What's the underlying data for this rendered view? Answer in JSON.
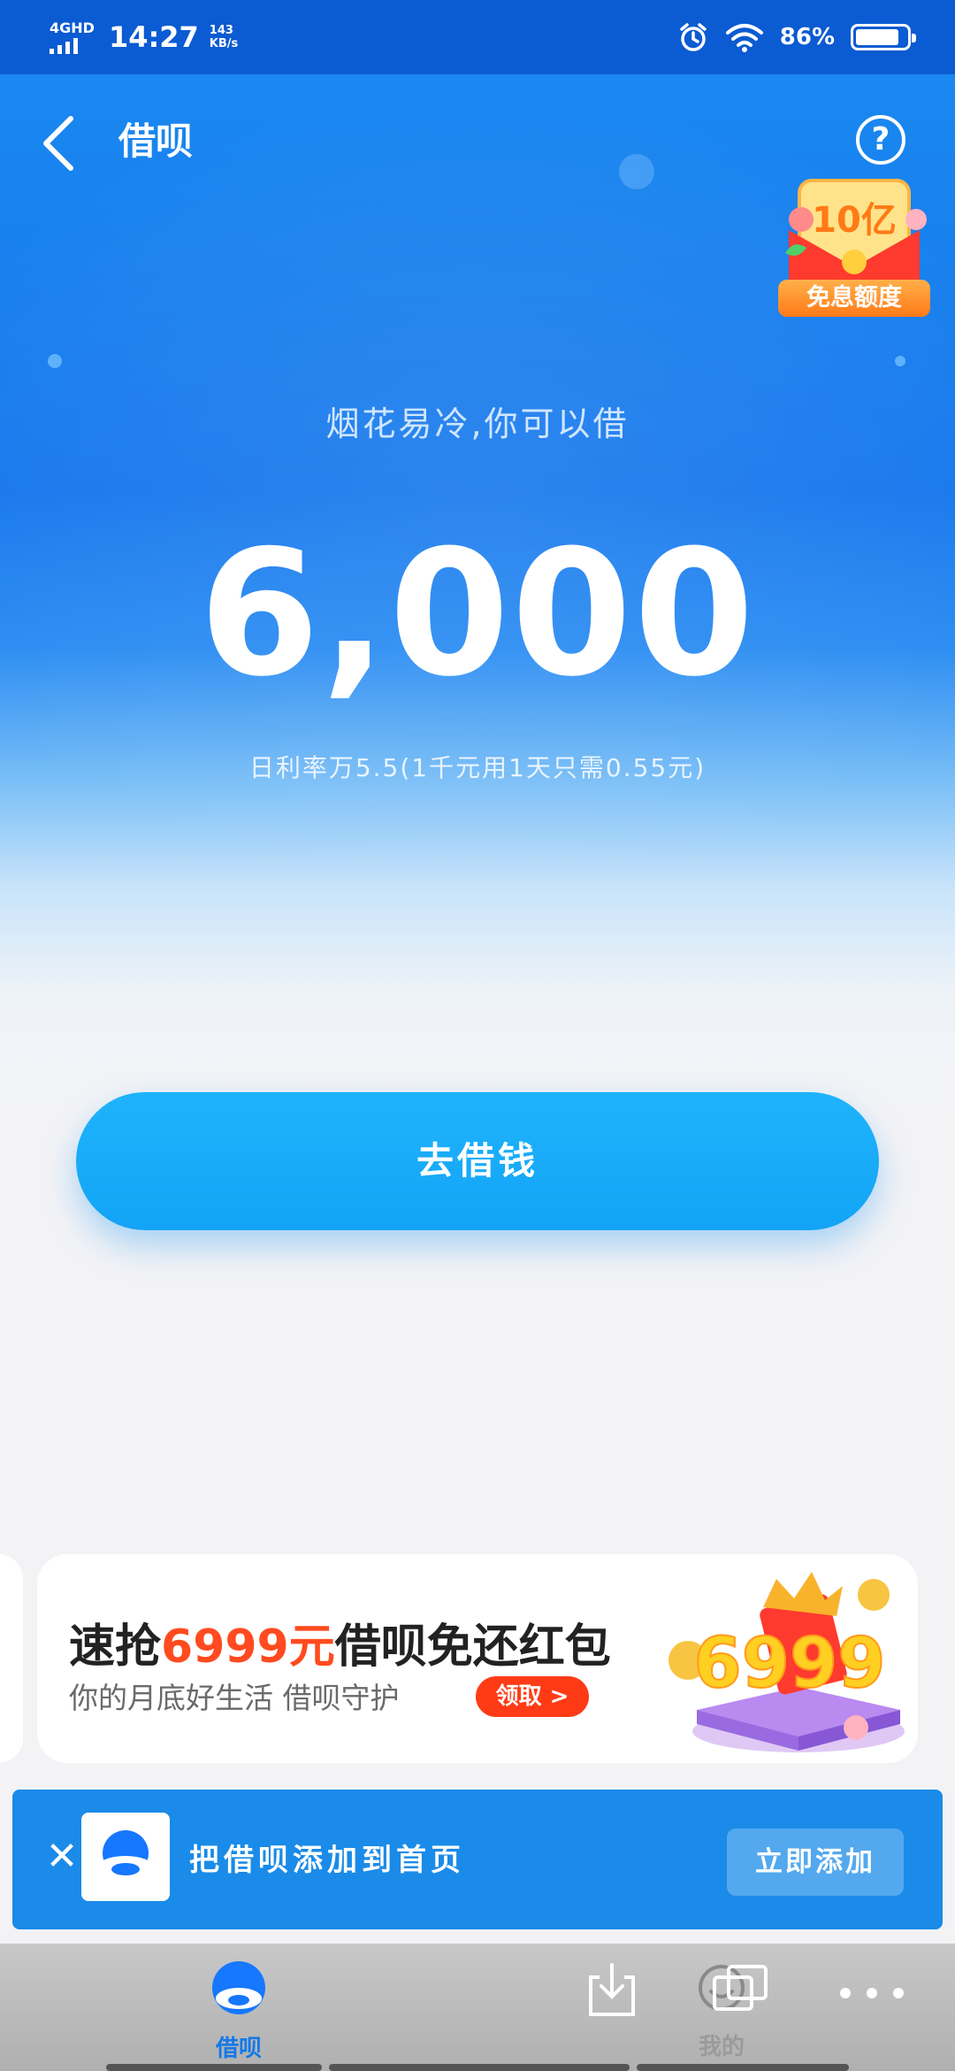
{
  "statusbar": {
    "network": "4GHD",
    "time": "14:27",
    "speed_value": "143",
    "speed_unit": "KB/s",
    "battery_pct": "86%",
    "battery_level": 0.86
  },
  "header": {
    "title": "借呗",
    "help": "?"
  },
  "promo_badge": {
    "amount": "10亿",
    "label": "免息额度"
  },
  "hero": {
    "slogan": "烟花易冷,你可以借",
    "credit_amount": "6,000",
    "rate_text": "日利率万5.5(1千元用1天只需0.55元)"
  },
  "borrow_button": {
    "label": "去借钱"
  },
  "banner": {
    "title_prefix": "速抢",
    "title_amount": "6999元",
    "title_suffix": "借呗免还红包",
    "subtitle": "你的月底好生活 借呗守护",
    "cta": "领取 >",
    "art_number": "6999"
  },
  "add_to_home": {
    "close": "✕",
    "text": "把借呗添加到首页",
    "button": "立即添加"
  },
  "bottom_nav": {
    "items": [
      {
        "label": "借呗",
        "active": true
      },
      {
        "label": "我的",
        "active": false
      }
    ]
  },
  "colors": {
    "status_bar": "#0b5bd2",
    "hero_blue": "#1576ec",
    "primary_button": "#13a4f6",
    "highlight_red": "#ff4b1f",
    "nav_active": "#1479e8"
  }
}
